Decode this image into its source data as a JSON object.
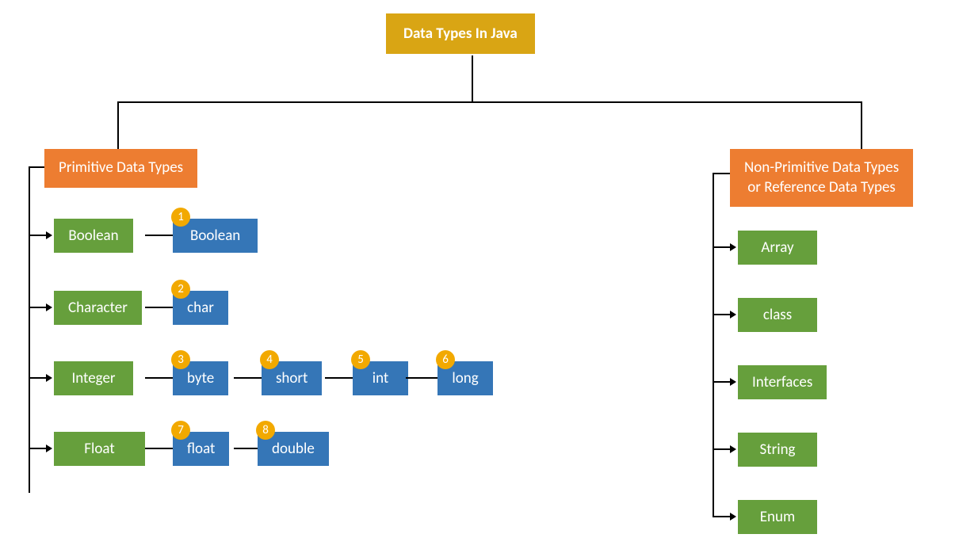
{
  "title": "Data Types In Java",
  "primitive": {
    "header": "Primitive Data Types",
    "categories": {
      "boolean": {
        "label": "Boolean",
        "types": [
          {
            "num": "1",
            "name": "Boolean"
          }
        ]
      },
      "character": {
        "label": "Character",
        "types": [
          {
            "num": "2",
            "name": "char"
          }
        ]
      },
      "integer": {
        "label": "Integer",
        "types": [
          {
            "num": "3",
            "name": "byte"
          },
          {
            "num": "4",
            "name": "short"
          },
          {
            "num": "5",
            "name": "int"
          },
          {
            "num": "6",
            "name": "long"
          }
        ]
      },
      "float": {
        "label": "Float",
        "types": [
          {
            "num": "7",
            "name": "float"
          },
          {
            "num": "8",
            "name": "double"
          }
        ]
      }
    }
  },
  "nonprimitive": {
    "header_line1": "Non-Primitive Data Types",
    "header_line2": "or Reference Data Types",
    "types": [
      "Array",
      "class",
      "Interfaces",
      "String",
      "Enum"
    ]
  }
}
